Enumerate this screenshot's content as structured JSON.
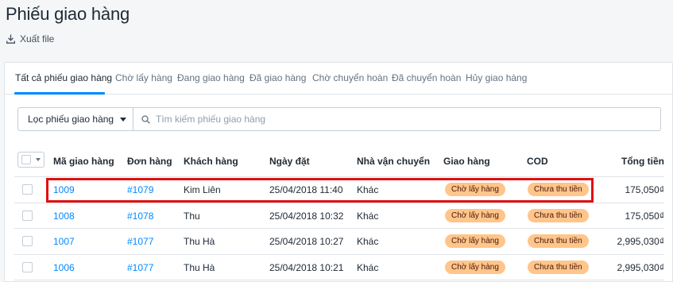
{
  "page": {
    "title": "Phiếu giao hàng",
    "export_label": "Xuất file"
  },
  "tabs": [
    {
      "label": "Tất cả phiếu giao hàng"
    },
    {
      "label": "Chờ lấy hàng"
    },
    {
      "label": "Đang giao hàng"
    },
    {
      "label": "Đã giao hàng"
    },
    {
      "label": "Chờ chuyển hoàn"
    },
    {
      "label": "Đã chuyển hoàn"
    },
    {
      "label": "Hủy giao hàng"
    }
  ],
  "filter": {
    "label": "Lọc phiếu giao hàng",
    "search_placeholder": "Tìm kiếm phiếu giao hàng"
  },
  "table": {
    "headers": [
      "Mã giao hàng",
      "Đơn hàng",
      "Khách hàng",
      "Ngày đặt",
      "Nhà vận chuyển",
      "Giao hàng",
      "COD",
      "Tổng tiền"
    ],
    "rows": [
      {
        "code": "1009",
        "order": "#1079",
        "customer": "Kim Liên",
        "date": "25/04/2018 11:40",
        "carrier": "Khác",
        "delivery": "Chờ lấy hàng",
        "cod": "Chưa thu tiền",
        "total": "175,050₫"
      },
      {
        "code": "1008",
        "order": "#1078",
        "customer": "Thu",
        "date": "25/04/2018 10:32",
        "carrier": "Khác",
        "delivery": "Chờ lấy hàng",
        "cod": "Chưa thu tiền",
        "total": "175,050₫"
      },
      {
        "code": "1007",
        "order": "#1077",
        "customer": "Thu Hà",
        "date": "25/04/2018 10:27",
        "carrier": "Khác",
        "delivery": "Chờ lấy hàng",
        "cod": "Chưa thu tiền",
        "total": "2,995,030₫"
      },
      {
        "code": "1006",
        "order": "#1077",
        "customer": "Thu Hà",
        "date": "25/04/2018 10:21",
        "carrier": "Khác",
        "delivery": "Chờ lấy hàng",
        "cod": "Chưa thu tiền",
        "total": "2,995,030₫"
      }
    ]
  }
}
